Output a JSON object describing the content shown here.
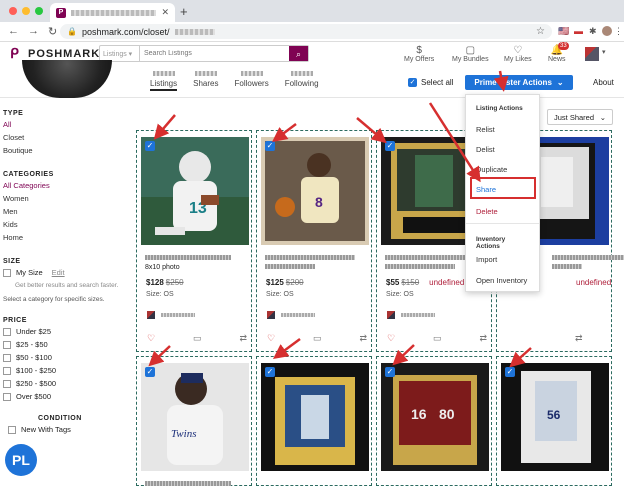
{
  "browser": {
    "tab_favicon": "P",
    "new_tab": "+",
    "url": "poshmark.com/closet/",
    "nav": {
      "back": "←",
      "forward": "→",
      "reload": "↻"
    }
  },
  "header": {
    "logo": "POSHMARK",
    "search_scope": "Listings",
    "search_placeholder": "Search Listings",
    "nav": [
      {
        "label": "My Offers",
        "icon": "offers-icon"
      },
      {
        "label": "My Bundles",
        "icon": "bundle-icon"
      },
      {
        "label": "My Likes",
        "icon": "heart-icon"
      },
      {
        "label": "News",
        "icon": "bell-icon",
        "badge": "33"
      }
    ]
  },
  "profile_tabs": [
    {
      "label": "Listings",
      "active": true
    },
    {
      "label": "Shares"
    },
    {
      "label": "Followers"
    },
    {
      "label": "Following"
    }
  ],
  "toolbar": {
    "select_all": "Select all",
    "prime_lister": "Prime Lister Actions",
    "about": "About",
    "sort": "Just Shared"
  },
  "sidebar": {
    "type_heading": "TYPE",
    "types": [
      "All",
      "Closet",
      "Boutique"
    ],
    "categories_heading": "CATEGORIES",
    "categories": [
      "All Categories",
      "Women",
      "Men",
      "Kids",
      "Home"
    ],
    "size_heading": "SIZE",
    "my_size": "My Size",
    "edit": "Edit",
    "size_note": "Get better results and search faster.",
    "size_note2": "Select a category for specific sizes.",
    "price_heading": "PRICE",
    "prices": [
      "Under $25",
      "$25 - $50",
      "$50 - $100",
      "$100 - $250",
      "$250 - $500",
      "Over $500"
    ],
    "condition_heading": "CONDITION",
    "conditions": [
      "New With Tags"
    ]
  },
  "pl_badge": "PL",
  "listings": [
    {
      "price": "$128",
      "original": "$250",
      "size": "Size: OS",
      "undefined": "",
      "title_tail": "8x10 photo"
    },
    {
      "price": "$125",
      "original": "$200",
      "size": "Size: OS",
      "undefined": "",
      "title_tail": ""
    },
    {
      "price": "$55",
      "original": "$150",
      "size": "Size: OS",
      "undefined": "undefined",
      "title_tail": ""
    },
    {
      "price": "",
      "original": "",
      "size": "",
      "undefined": "undefined",
      "title_tail": ""
    }
  ],
  "menu": {
    "listing_actions": "Listing Actions",
    "items1": [
      "Relist",
      "Delist",
      "Duplicate",
      "Share",
      "Delete"
    ],
    "inventory_actions": "Inventory Actions",
    "items2": [
      "Import",
      "Open Inventory"
    ]
  },
  "colors": {
    "brand": "#7f0353",
    "accent": "#1e73d8",
    "annotation": "#d62f2f"
  }
}
